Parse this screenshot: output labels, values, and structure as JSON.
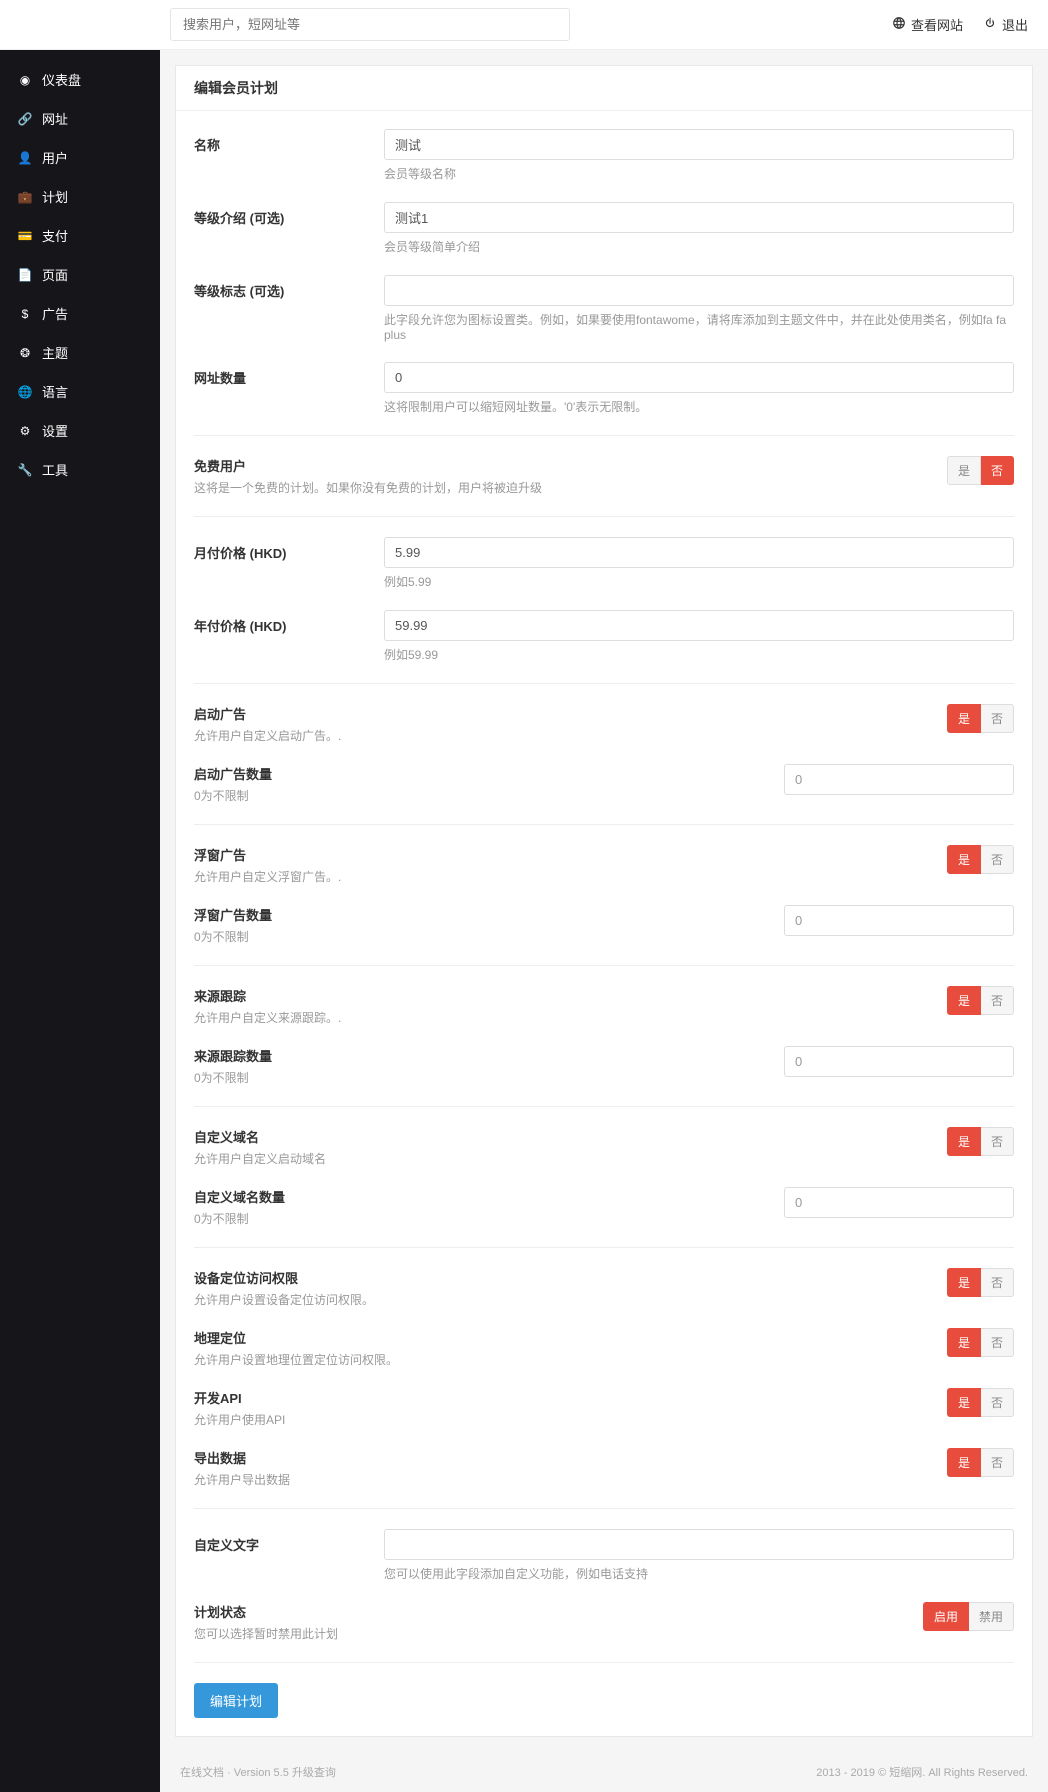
{
  "search": {
    "placeholder": "搜索用户，短网址等"
  },
  "topbar": {
    "view_site": "查看网站",
    "logout": "退出"
  },
  "sidebar": {
    "items": [
      {
        "label": "仪表盘",
        "icon": "dashboard"
      },
      {
        "label": "网址",
        "icon": "link"
      },
      {
        "label": "用户",
        "icon": "user"
      },
      {
        "label": "计划",
        "icon": "briefcase"
      },
      {
        "label": "支付",
        "icon": "card"
      },
      {
        "label": "页面",
        "icon": "file"
      },
      {
        "label": "广告",
        "icon": "dollar"
      },
      {
        "label": "主题",
        "icon": "palette"
      },
      {
        "label": "语言",
        "icon": "globe"
      },
      {
        "label": "设置",
        "icon": "gear"
      },
      {
        "label": "工具",
        "icon": "wrench"
      }
    ]
  },
  "panel": {
    "title": "编辑会员计划"
  },
  "form": {
    "name": {
      "label": "名称",
      "value": "测试",
      "help": "会员等级名称"
    },
    "intro": {
      "label": "等级介绍 (可选)",
      "value": "测试1",
      "help": "会员等级简单介绍"
    },
    "badge": {
      "label": "等级标志 (可选)",
      "value": "",
      "help": "此字段允许您为图标设置类。例如，如果要使用fontawome，请将库添加到主题文件中，并在此处使用类名，例如fa fa plus"
    },
    "url_count": {
      "label": "网址数量",
      "value": "0",
      "help": "这将限制用户可以缩短网址数量。'0'表示无限制。"
    },
    "free_user": {
      "title": "免费用户",
      "desc": "这将是一个免费的计划。如果你没有免费的计划，用户将被迫升级"
    },
    "monthly": {
      "label": "月付价格 (HKD)",
      "value": "5.99",
      "help": "例如5.99"
    },
    "yearly": {
      "label": "年付价格 (HKD)",
      "value": "59.99",
      "help": "例如59.99"
    },
    "splash": {
      "title": "启动广告",
      "desc": "允许用户自定义启动广告。."
    },
    "splash_count": {
      "title": "启动广告数量",
      "desc": "0为不限制",
      "value": "0"
    },
    "overlay": {
      "title": "浮窗广告",
      "desc": "允许用户自定义浮窗广告。."
    },
    "overlay_count": {
      "title": "浮窗广告数量",
      "desc": "0为不限制",
      "value": "0"
    },
    "pixel": {
      "title": "来源跟踪",
      "desc": "允许用户自定义来源跟踪。."
    },
    "pixel_count": {
      "title": "来源跟踪数量",
      "desc": "0为不限制",
      "value": "0"
    },
    "domain": {
      "title": "自定义域名",
      "desc": "允许用户自定义启动域名"
    },
    "domain_count": {
      "title": "自定义域名数量",
      "desc": "0为不限制",
      "value": "0"
    },
    "device": {
      "title": "设备定位访问权限",
      "desc": "允许用户设置设备定位访问权限。"
    },
    "geo": {
      "title": "地理定位",
      "desc": "允许用户设置地理位置定位访问权限。"
    },
    "api": {
      "title": "开发API",
      "desc": "允许用户使用API"
    },
    "export": {
      "title": "导出数据",
      "desc": "允许用户导出数据"
    },
    "custom_text": {
      "label": "自定义文字",
      "value": "",
      "help": "您可以使用此字段添加自定义功能，例如电话支持"
    },
    "status": {
      "title": "计划状态",
      "desc": "您可以选择暂时禁用此计划"
    }
  },
  "toggle": {
    "yes": "是",
    "no": "否",
    "enable": "启用",
    "disable": "禁用"
  },
  "submit": "编辑计划",
  "footer": {
    "left_prefix": "在线文档",
    "left_version": " · Version 5.5 ",
    "left_upgrade": "升级查询",
    "right": "2013 - 2019 © 短缩网. All Rights Reserved."
  }
}
